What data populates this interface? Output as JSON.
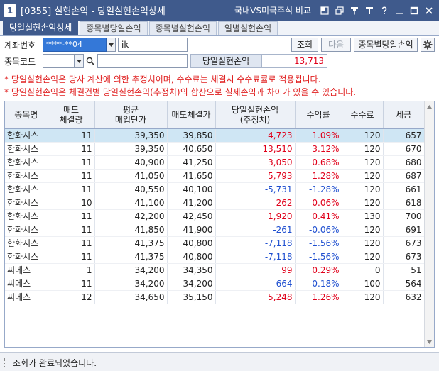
{
  "window": {
    "app_number": "1",
    "title": "[0355]  실현손익 - 당일실현손익상세",
    "compare_label": "국내VS미국주식 비교",
    "controls": [
      "window-icon",
      "restore-icon",
      "pin-icon",
      "font-icon",
      "help-icon",
      "minimize-icon",
      "maximize-icon",
      "close-icon"
    ]
  },
  "tabs": [
    {
      "label": "당일실현손익상세",
      "active": true
    },
    {
      "label": "종목별당일손익",
      "active": false
    },
    {
      "label": "종목별실현손익",
      "active": false
    },
    {
      "label": "일별실현손익",
      "active": false
    }
  ],
  "form": {
    "account_label": "계좌번호",
    "account_value": "****-**04",
    "account_name": "ik",
    "query_button": "조회",
    "next_button": "다음",
    "by_stock_button": "종목별당일손익",
    "stock_code_label": "종목코드",
    "pl_label": "당일실현손익",
    "pl_value": "13,713"
  },
  "notices": [
    "* 당일실현손익은 당사 계산에 의한 추정치이며, 수수료는 체결시 수수료률로 적용됩니다.",
    "* 당일실현손익은 체결건별 당일실현손익(추정치)의 합산으로 실제손익과 차이가 있을 수 있습니다."
  ],
  "table": {
    "headers": [
      {
        "line1": "종목명",
        "line2": ""
      },
      {
        "line1": "매도",
        "line2": "체결량"
      },
      {
        "line1": "평균",
        "line2": "매입단가"
      },
      {
        "line1": "매도체결가",
        "line2": ""
      },
      {
        "line1": "당일실현손익",
        "line2": "(추정치)"
      },
      {
        "line1": "수익률",
        "line2": ""
      },
      {
        "line1": "수수료",
        "line2": ""
      },
      {
        "line1": "세금",
        "line2": ""
      }
    ],
    "rows": [
      {
        "name": "한화시스",
        "qty": "11",
        "avg_price": "39,350",
        "sell_price": "39,850",
        "pl": "4,723",
        "rate": "1.09%",
        "fee": "120",
        "tax": "657",
        "sign": "pos",
        "selected": true
      },
      {
        "name": "한화시스",
        "qty": "11",
        "avg_price": "39,350",
        "sell_price": "40,650",
        "pl": "13,510",
        "rate": "3.12%",
        "fee": "120",
        "tax": "670",
        "sign": "pos",
        "selected": false
      },
      {
        "name": "한화시스",
        "qty": "11",
        "avg_price": "40,900",
        "sell_price": "41,250",
        "pl": "3,050",
        "rate": "0.68%",
        "fee": "120",
        "tax": "680",
        "sign": "pos",
        "selected": false
      },
      {
        "name": "한화시스",
        "qty": "11",
        "avg_price": "41,050",
        "sell_price": "41,650",
        "pl": "5,793",
        "rate": "1.28%",
        "fee": "120",
        "tax": "687",
        "sign": "pos",
        "selected": false
      },
      {
        "name": "한화시스",
        "qty": "11",
        "avg_price": "40,550",
        "sell_price": "40,100",
        "pl": "-5,731",
        "rate": "-1.28%",
        "fee": "120",
        "tax": "661",
        "sign": "neg",
        "selected": false
      },
      {
        "name": "한화시스",
        "qty": "10",
        "avg_price": "41,100",
        "sell_price": "41,200",
        "pl": "262",
        "rate": "0.06%",
        "fee": "120",
        "tax": "618",
        "sign": "pos",
        "selected": false
      },
      {
        "name": "한화시스",
        "qty": "11",
        "avg_price": "42,200",
        "sell_price": "42,450",
        "pl": "1,920",
        "rate": "0.41%",
        "fee": "130",
        "tax": "700",
        "sign": "pos",
        "selected": false
      },
      {
        "name": "한화시스",
        "qty": "11",
        "avg_price": "41,850",
        "sell_price": "41,900",
        "pl": "-261",
        "rate": "-0.06%",
        "fee": "120",
        "tax": "691",
        "sign": "neg",
        "selected": false
      },
      {
        "name": "한화시스",
        "qty": "11",
        "avg_price": "41,375",
        "sell_price": "40,800",
        "pl": "-7,118",
        "rate": "-1.56%",
        "fee": "120",
        "tax": "673",
        "sign": "neg",
        "selected": false
      },
      {
        "name": "한화시스",
        "qty": "11",
        "avg_price": "41,375",
        "sell_price": "40,800",
        "pl": "-7,118",
        "rate": "-1.56%",
        "fee": "120",
        "tax": "673",
        "sign": "neg",
        "selected": false
      },
      {
        "name": "씨메스",
        "qty": "1",
        "avg_price": "34,200",
        "sell_price": "34,350",
        "pl": "99",
        "rate": "0.29%",
        "fee": "0",
        "tax": "51",
        "sign": "pos",
        "selected": false
      },
      {
        "name": "씨메스",
        "qty": "11",
        "avg_price": "34,200",
        "sell_price": "34,200",
        "pl": "-664",
        "rate": "-0.18%",
        "fee": "100",
        "tax": "564",
        "sign": "neg",
        "selected": false
      },
      {
        "name": "씨메스",
        "qty": "12",
        "avg_price": "34,650",
        "sell_price": "35,150",
        "pl": "5,248",
        "rate": "1.26%",
        "fee": "120",
        "tax": "632",
        "sign": "pos",
        "selected": false
      }
    ]
  },
  "status": {
    "message": "조회가 완료되었습니다."
  },
  "colors": {
    "title_bar": "#3f5a8c",
    "positive": "#e0001a",
    "negative": "#1f4fd0",
    "selected_row": "#cfe6f4",
    "notice": "#e02020"
  }
}
